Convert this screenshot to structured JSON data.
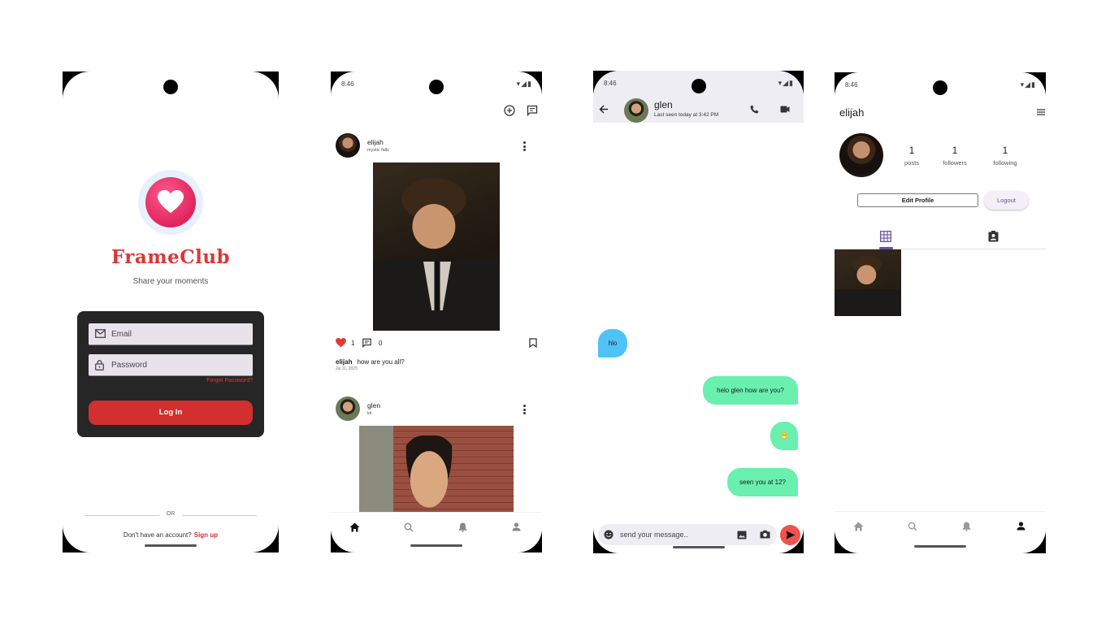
{
  "status": {
    "time": "8:46"
  },
  "login": {
    "app_name": "FrameClub",
    "tagline": "Share your moments",
    "email_placeholder": "Email",
    "password_placeholder": "Password",
    "forgot_password": "Forgot Password?",
    "login_button": "Log In",
    "or_text": "OR",
    "no_account_text": "Don't have an account?",
    "signup_link": "Sign up",
    "colors": {
      "brand": "#d93838",
      "card": "#262626",
      "button": "#d32f2f"
    }
  },
  "feed": {
    "posts": [
      {
        "username": "elijah",
        "location": "mystic falls",
        "likes": "1",
        "comments": "0",
        "caption_user": "elijah",
        "caption": "how are you all?",
        "date": "Jul 11, 2025"
      },
      {
        "username": "glen",
        "location": "kk"
      }
    ]
  },
  "chat": {
    "contact_name": "glen",
    "last_seen": "Last seen today at 3:42 PM",
    "messages": [
      {
        "direction": "in",
        "text": "hlo"
      },
      {
        "direction": "out",
        "text": "helo glen how are you?"
      },
      {
        "direction": "out",
        "text": "😁"
      },
      {
        "direction": "out",
        "text": "seen you at 12?"
      }
    ],
    "input_placeholder": "send your message..",
    "colors": {
      "incoming": "#4fc3f7",
      "outgoing": "#69f0ae",
      "send": "#ef5350"
    }
  },
  "profile": {
    "username": "elijah",
    "stats": [
      {
        "count": "1",
        "label": "posts"
      },
      {
        "count": "1",
        "label": "followers"
      },
      {
        "count": "1",
        "label": "following"
      }
    ],
    "edit_profile": "Edit Profile",
    "logout": "Logout",
    "accent": "#6750a4"
  }
}
